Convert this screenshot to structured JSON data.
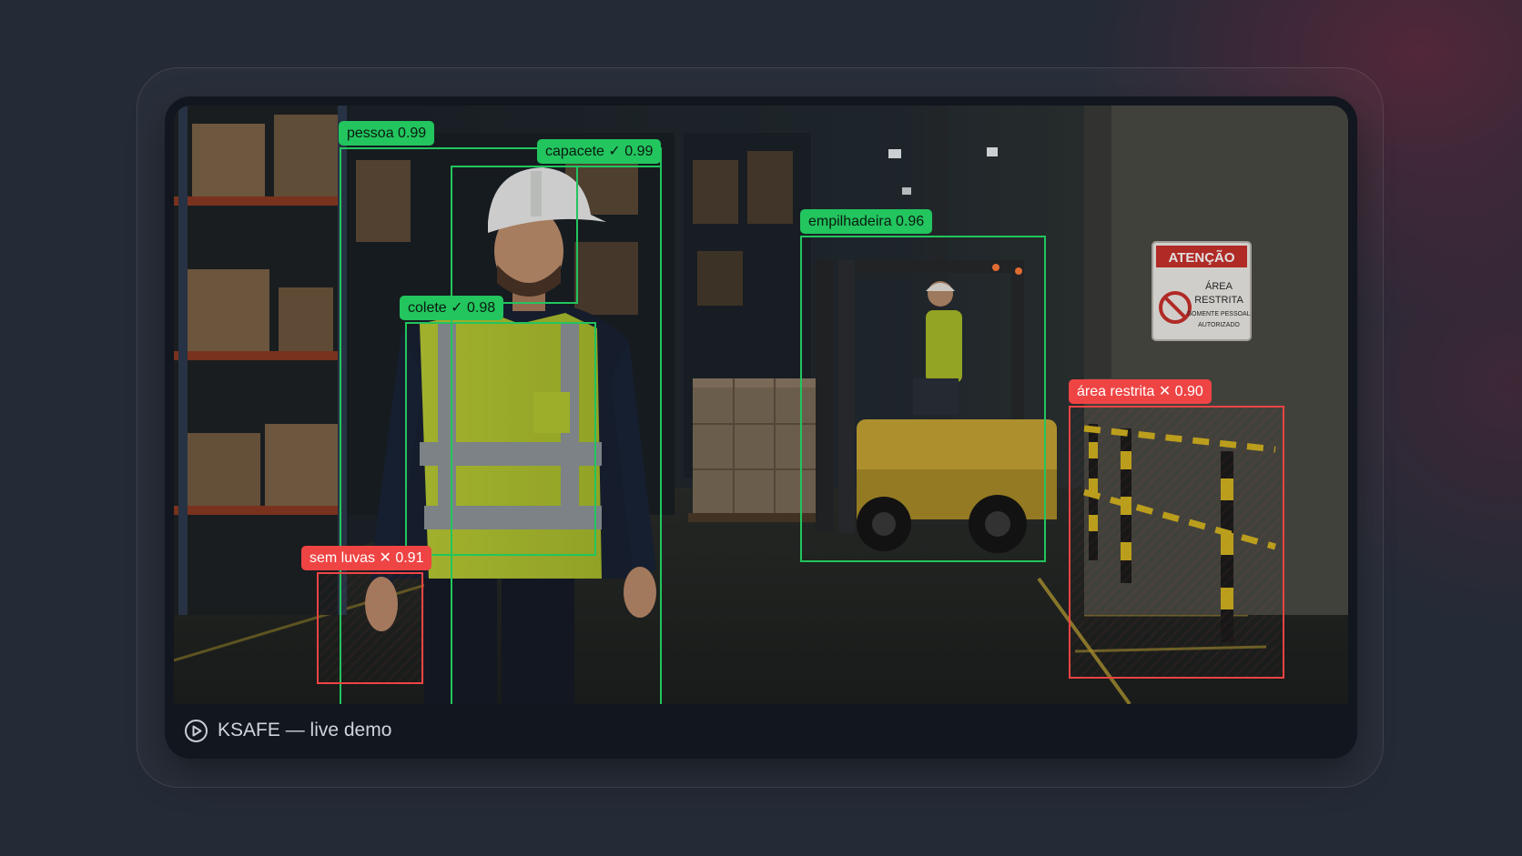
{
  "caption": {
    "icon": "play-icon",
    "text": "KSAFE — live demo"
  },
  "detections": {
    "pessoa": {
      "label": "pessoa  0.99",
      "status": "ok"
    },
    "capacete": {
      "label": "capacete ✓ 0.99",
      "status": "ok"
    },
    "colete": {
      "label": "colete ✓ 0.98",
      "status": "ok"
    },
    "empilhadeira": {
      "label": "empilhadeira  0.96",
      "status": "ok"
    },
    "area_restrita": {
      "label": "área restrita ✕ 0.90",
      "status": "violation"
    },
    "sem_luvas": {
      "label": "sem luvas ✕ 0.91",
      "status": "violation"
    }
  },
  "scene": {
    "sign": {
      "title": "ATENÇÃO",
      "lines": [
        "ÁREA",
        "RESTRITA",
        "SOMENTE PESSOAL",
        "AUTORIZADO"
      ]
    }
  },
  "colors": {
    "ok": "#22c55e",
    "violation": "#ef4444",
    "background": "#242a36"
  }
}
